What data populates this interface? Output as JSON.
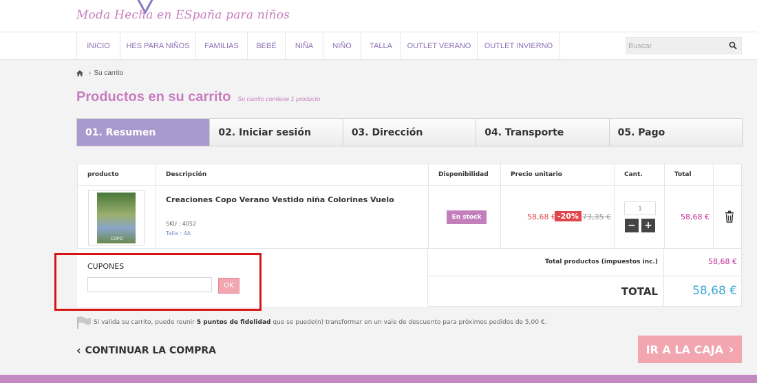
{
  "brand": {
    "logo_text": "Moda Hecha en ESpaña para niños"
  },
  "nav": {
    "items": [
      "INICIO",
      "HES PARA NIÑOS",
      "FAMILIAS",
      "BEBÉ",
      "NIÑA",
      "NIÑO",
      "TALLA",
      "OUTLET VERANO",
      "OUTLET INVIERNO"
    ],
    "search_placeholder": "Buscar"
  },
  "breadcrumb": {
    "current": "Su carrito"
  },
  "page": {
    "title": "Productos en su carrito",
    "subtitle": "Su carrito contiene 1 producto"
  },
  "steps": [
    "01. Resumen",
    "02. Iniciar sesión",
    "03. Dirección",
    "04. Transporte",
    "05. Pago"
  ],
  "table": {
    "headers": [
      "producto",
      "Descripción",
      "Disponibilidad",
      "Precio unitario",
      "Cant.",
      "Total"
    ]
  },
  "product": {
    "name": "Creaciones Copo Verano Vestido niña Colorines Vuelo",
    "sku": "SKU : 4052",
    "talla": "Talla : 4A",
    "availability": "En stock",
    "price_new": "58,68 €",
    "discount": "-20%",
    "price_old": "73,35 €",
    "quantity": "1",
    "total": "58,68 €",
    "image_brand": "COPO"
  },
  "coupons": {
    "label": "CUPONES",
    "ok_label": "OK"
  },
  "totals": {
    "products_label": "Total productos (impuestos inc.)",
    "products_value": "58,68 €",
    "grand_label": "TOTAL",
    "grand_value": "58,68 €"
  },
  "loyalty": {
    "text_before": "Si valida su carrito, puede reunir",
    "points": "5 puntos de fidelidad",
    "text_after": "que se puede(n) transformar en un vale de descuento para próximos pedidos de 5,00 €."
  },
  "actions": {
    "continue_label": "CONTINUAR LA COMPRA",
    "checkout_label": "IR A LA CAJA"
  },
  "colors": {
    "accent": "#c77dbf",
    "step_active": "#a999cf",
    "price_red": "#e0474c",
    "total_blue": "#3ba7d6",
    "checkout": "#f2a7b0",
    "highlight": "#d71414"
  }
}
